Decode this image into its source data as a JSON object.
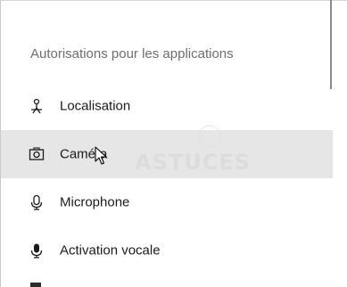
{
  "section": {
    "title": "Autorisations pour les applications"
  },
  "nav": {
    "items": [
      {
        "label": "Localisation",
        "icon": "location-person-icon",
        "selected": false
      },
      {
        "label": "Caméra",
        "icon": "camera-icon",
        "selected": true
      },
      {
        "label": "Microphone",
        "icon": "microphone-icon",
        "selected": false
      },
      {
        "label": "Activation vocale",
        "icon": "microphone-filled-icon",
        "selected": false
      }
    ]
  },
  "watermark": {
    "text": "ASTUCES"
  },
  "colors": {
    "selected_bg": "#e6e6e6",
    "text": "#1b1b1b",
    "section_title": "#6e6e6e"
  }
}
